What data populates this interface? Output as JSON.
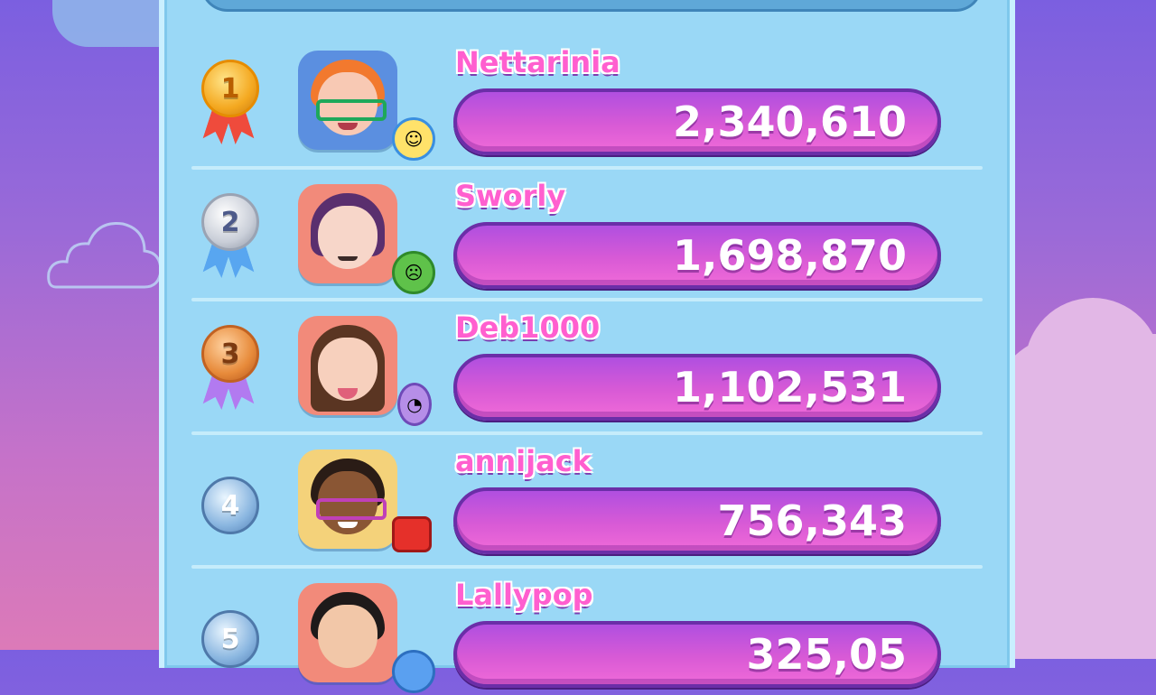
{
  "colors": {
    "background_top": "#7b5fe0",
    "panel": "#9ad8f6",
    "name_pink": "#ff5fcf",
    "score_bar": "#d85ad6"
  },
  "leaderboard": [
    {
      "rank": "1",
      "name": "Nettarinia",
      "score": "2,340,610",
      "medal": "gold",
      "badge_icon": "joy-icon"
    },
    {
      "rank": "2",
      "name": "Sworly",
      "score": "1,698,870",
      "medal": "silver",
      "badge_icon": "disgust-icon"
    },
    {
      "rank": "3",
      "name": "Deb1000",
      "score": "1,102,531",
      "medal": "bronze",
      "badge_icon": "fear-icon"
    },
    {
      "rank": "4",
      "name": "annijack",
      "score": "756,343",
      "medal": "plain",
      "badge_icon": "anger-icon"
    },
    {
      "rank": "5",
      "name": "Lallypop",
      "score": "325,05",
      "medal": "plain",
      "badge_icon": "sadness-icon"
    }
  ]
}
